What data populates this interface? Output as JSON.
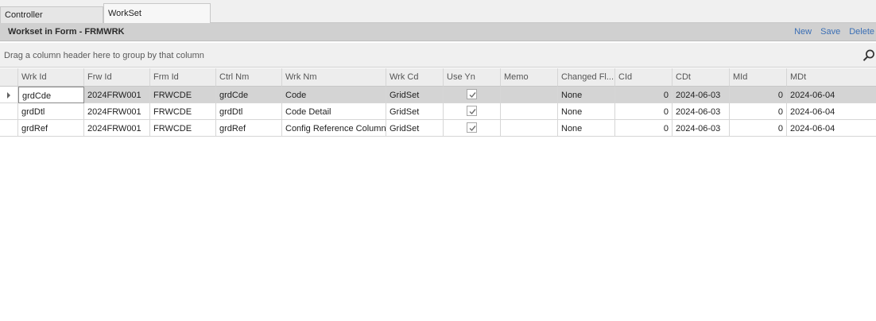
{
  "tabs": [
    "Controller",
    "WorkSet"
  ],
  "panel": {
    "title": "Workset in Form - FRMWRK",
    "actions": {
      "new": "New",
      "save": "Save",
      "delete": "Delete"
    }
  },
  "group_hint": "Drag a column header here to group by that column",
  "colors": {
    "accent_link": "#3b6fb5",
    "header_bar": "#d0d0d0",
    "selected_row": "#d4d4d4"
  },
  "icons": {
    "search": "search-icon",
    "row_indicator": "row-indicator-arrow-icon",
    "checkbox": "checkbox-checked-icon"
  },
  "grid": {
    "columns": [
      "Wrk Id",
      "Frw Id",
      "Frm Id",
      "Ctrl Nm",
      "Wrk Nm",
      "Wrk Cd",
      "Use Yn",
      "Memo",
      "Changed Fl...",
      "CId",
      "CDt",
      "MId",
      "MDt"
    ],
    "rows": [
      {
        "wrk_id": "grdCde",
        "frw_id": "2024FRW001",
        "frm_id": "FRWCDE",
        "ctrl_nm": "grdCde",
        "wrk_nm": "Code",
        "wrk_cd": "GridSet",
        "use_yn": true,
        "memo": "",
        "changed": "None",
        "cid": "0",
        "cdt": "2024-06-03",
        "mid": "0",
        "mdt": "2024-06-04"
      },
      {
        "wrk_id": "grdDtl",
        "frw_id": "2024FRW001",
        "frm_id": "FRWCDE",
        "ctrl_nm": "grdDtl",
        "wrk_nm": "Code Detail",
        "wrk_cd": "GridSet",
        "use_yn": true,
        "memo": "",
        "changed": "None",
        "cid": "0",
        "cdt": "2024-06-03",
        "mid": "0",
        "mdt": "2024-06-04"
      },
      {
        "wrk_id": "grdRef",
        "frw_id": "2024FRW001",
        "frm_id": "FRWCDE",
        "ctrl_nm": "grdRef",
        "wrk_nm": "Config Reference Column",
        "wrk_cd": "GridSet",
        "use_yn": true,
        "memo": "",
        "changed": "None",
        "cid": "0",
        "cdt": "2024-06-03",
        "mid": "0",
        "mdt": "2024-06-04"
      }
    ]
  }
}
